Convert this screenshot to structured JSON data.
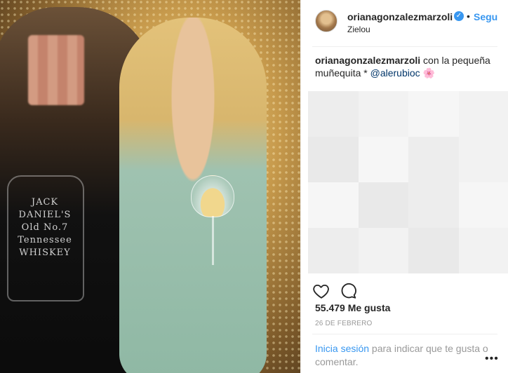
{
  "photo": {
    "shirt_text": "JACK DANIEL'S Old No.7 Tennessee WHISKEY"
  },
  "header": {
    "username": "orianagonzalezmarzoli",
    "verified_icon": "verified-badge-icon",
    "dot": "•",
    "follow_label": "Segu",
    "location": "Zielou"
  },
  "caption": {
    "username": "orianagonzalezmarzoli",
    "text": " con la pequeña muñequita * ",
    "mention": "@alerubioc",
    "emoji": "🌸"
  },
  "actions": {
    "like_icon": "heart-icon",
    "comment_icon": "comment-bubble-icon"
  },
  "likes": "55.479 Me gusta",
  "date": "26 DE FEBRERO",
  "footer": {
    "login_link": "Inicia sesión",
    "login_rest": " para indicar que te gusta o comentar.",
    "more_label": "•••"
  },
  "colors": {
    "accent": "#3897f0",
    "text": "#262626",
    "muted": "#999999"
  }
}
